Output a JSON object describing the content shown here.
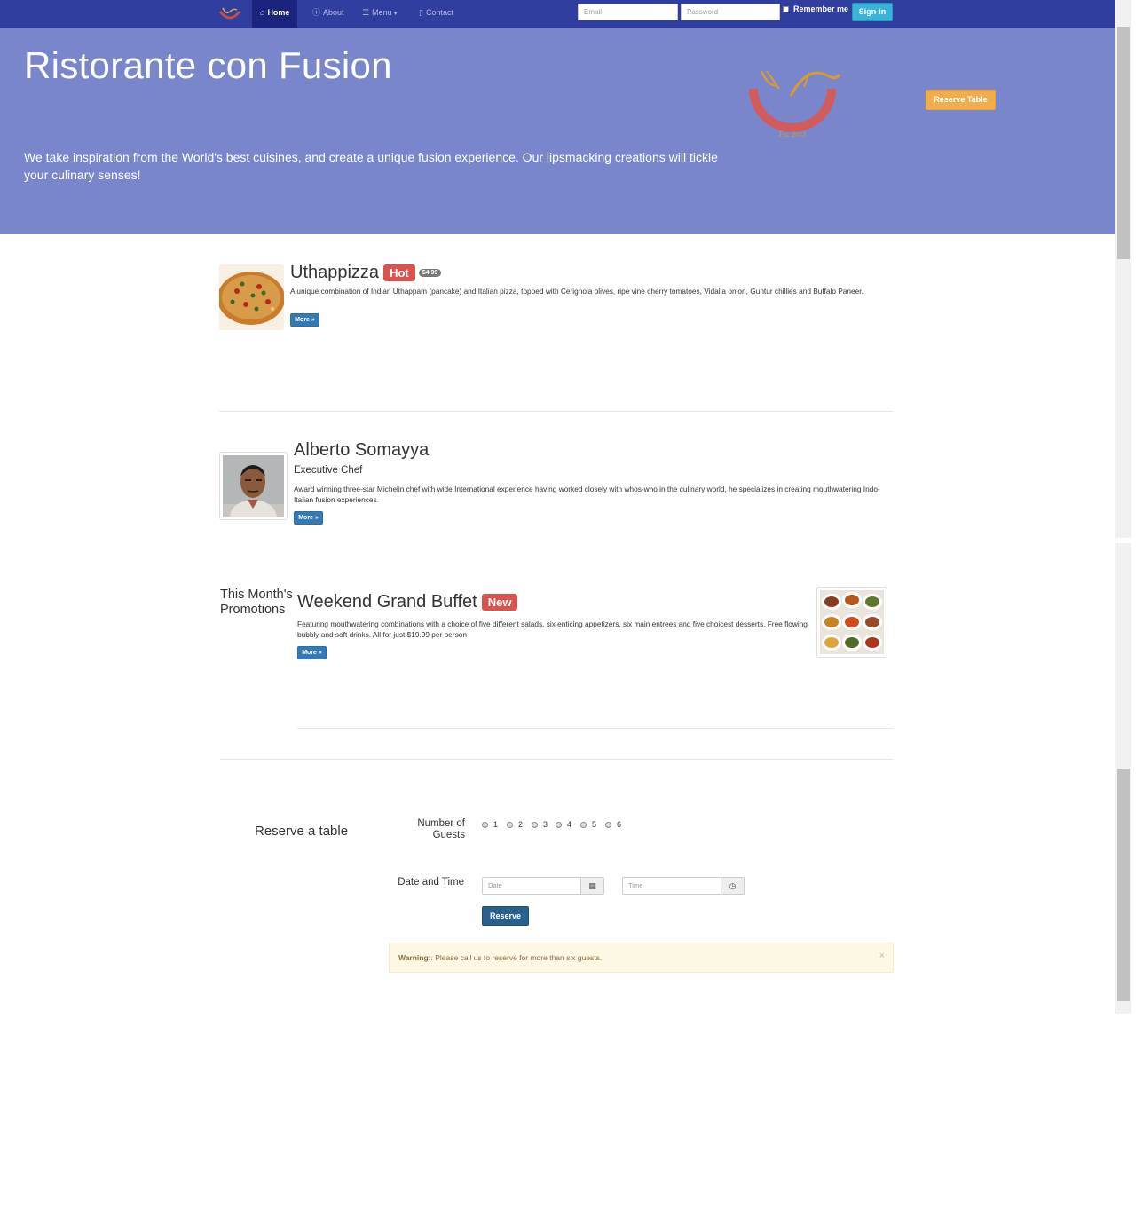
{
  "navbar": {
    "brand_icon": "ristorante-logo-icon",
    "items": [
      {
        "label": "Home",
        "icon": "home-icon",
        "active": true
      },
      {
        "label": "About",
        "icon": "info-icon"
      },
      {
        "label": "Menu",
        "icon": "list-icon"
      },
      {
        "label": "Contact",
        "icon": "contact-icon"
      }
    ],
    "email_placeholder": "Email",
    "password_placeholder": "Password",
    "remember_label": "Remember me",
    "signin_label": "Sign-in"
  },
  "jumbotron": {
    "title": "Ristorante con Fusion",
    "text": "We take inspiration from the World's best cuisines, and create a unique fusion experience. Our lipsmacking creations will tickle your culinary senses!",
    "logo_text": "Ristorante con Fusion",
    "logo_est": "Est. 2013",
    "reserve_label": "Reserve Table",
    "bg_color": "#7986cb"
  },
  "dish": {
    "name": "Uthappizza",
    "label": "Hot",
    "price": "$4.99",
    "description": "A unique combination of Indian Uthappam (pancake) and Italian pizza, topped with Cerignola olives, ripe vine cherry tomatoes, Vidalia onion, Guntur chillies and Buffalo Paneer.",
    "more_label": "More »"
  },
  "leader": {
    "name": "Alberto Somayya",
    "designation": "Executive Chef",
    "description": "Award winning three-star Michelin chef with wide International experience having worked closely with whos-who in the culinary world, he specializes in creating mouthwatering Indo-Italian fusion experiences.",
    "more_label": "More »"
  },
  "promotion": {
    "section_label": "This Month's Promotions",
    "name": "Weekend Grand Buffet",
    "label": "New",
    "description": "Featuring mouthwatering combinations with a choice of five different salads, six enticing appetizers, six main entrees and five choicest desserts. Free flowing bubbly and soft drinks. All for just $19.99 per person",
    "more_label": "More »"
  },
  "reservation": {
    "heading": "Reserve a table",
    "guests_label": "Number of Guests",
    "guests_options": [
      "1",
      "2",
      "3",
      "4",
      "5",
      "6"
    ],
    "datetime_label": "Date and Time",
    "date_placeholder": "Date",
    "time_placeholder": "Time",
    "submit_label": "Reserve",
    "warning_strong": "Warning:",
    "warning_text": ": Please call us to reserve for more than six guests.",
    "close_symbol": "×"
  }
}
